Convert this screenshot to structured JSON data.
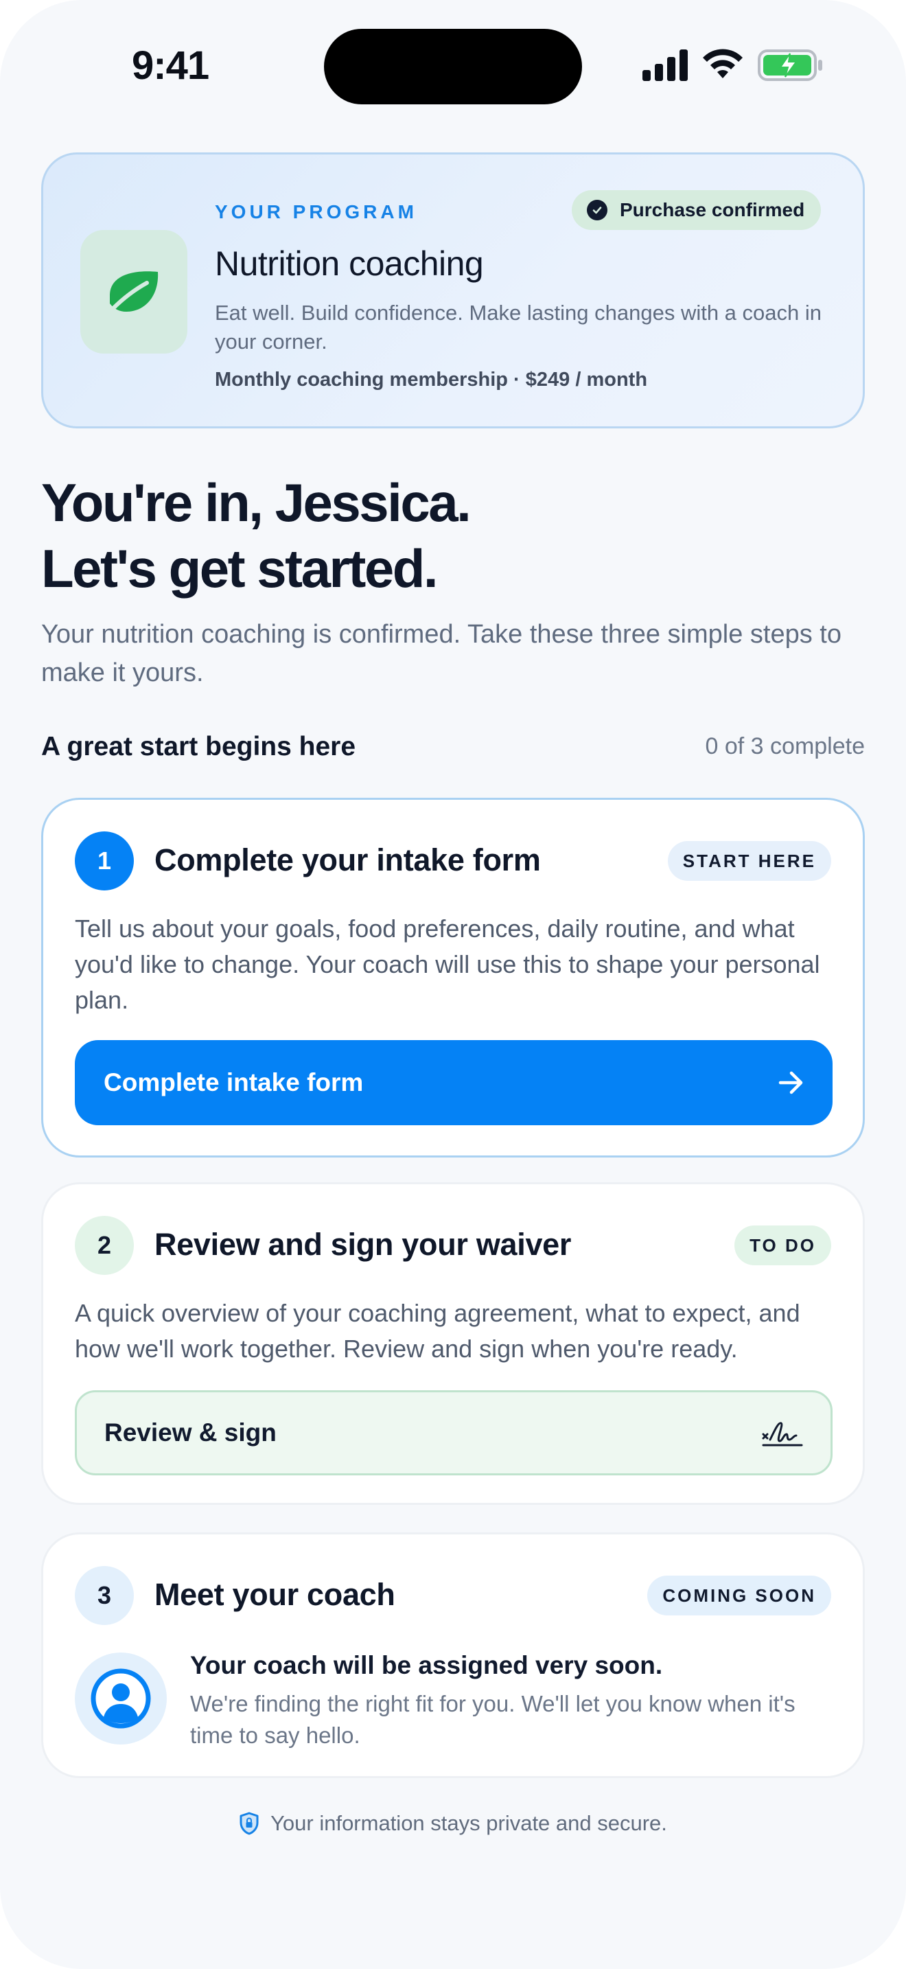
{
  "status_bar": {
    "time": "9:41"
  },
  "program": {
    "eyebrow": "YOUR PROGRAM",
    "badge": "Purchase confirmed",
    "title": "Nutrition coaching",
    "description": "Eat well. Build confidence. Make lasting changes with a coach in your corner.",
    "price_line": "Monthly coaching membership · $249 / month",
    "icon": "leaf-icon"
  },
  "hero": {
    "title_line1": "You're in, Jessica.",
    "title_line2": "Let's get started.",
    "subtitle": "Your nutrition coaching is confirmed. Take these three simple steps to make it yours."
  },
  "section": {
    "title": "A great start begins here",
    "progress": "0 of 3 complete"
  },
  "steps": [
    {
      "number": "1",
      "title": "Complete your intake form",
      "badge": "START HERE",
      "description": "Tell us about your goals, food preferences, daily routine, and what you'd like to change. Your coach will use this to shape your personal plan.",
      "action_label": "Complete intake form",
      "action_icon": "arrow-right-icon"
    },
    {
      "number": "2",
      "title": "Review and sign your waiver",
      "badge": "TO DO",
      "description": "A quick overview of your coaching agreement, what to expect, and how we'll work together. Review and sign when you're ready.",
      "action_label": "Review & sign",
      "action_icon": "signature-icon"
    },
    {
      "number": "3",
      "title": "Meet your coach",
      "badge": "COMING SOON",
      "coach_heading": "Your coach will be assigned very soon.",
      "coach_text": "We're finding the right fit for you. We'll let you know when it's time to say hello.",
      "icon": "user-circle-icon"
    }
  ],
  "footer": {
    "text": "Your information stays private and secure.",
    "icon": "shield-icon"
  },
  "colors": {
    "accent": "#0582f5",
    "success_bg": "#d6ecde",
    "leaf_green": "#1faa4f",
    "heading": "#0f1729",
    "muted": "#5f6b7f"
  }
}
